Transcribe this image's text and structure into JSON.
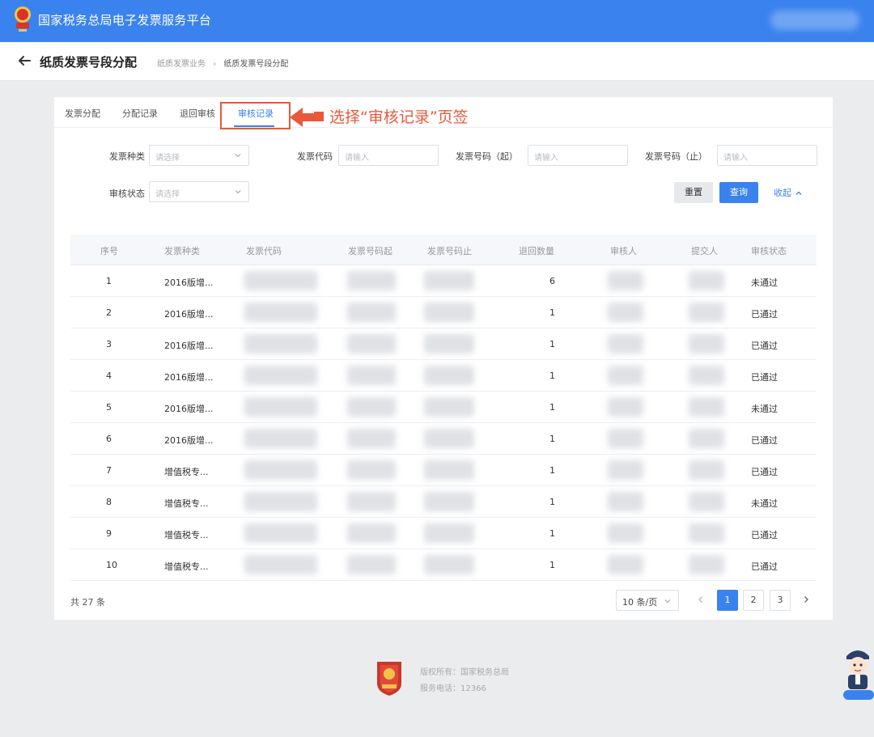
{
  "header": {
    "title": "国家税务总局电子发票服务平台"
  },
  "subheader": {
    "page_title": "纸质发票号段分配",
    "breadcrumb": [
      "纸质发票业务",
      "纸质发票号段分配"
    ]
  },
  "tabs": [
    {
      "label": "发票分配",
      "active": false
    },
    {
      "label": "分配记录",
      "active": false
    },
    {
      "label": "退回审核",
      "active": false
    },
    {
      "label": "审核记录",
      "active": true
    }
  ],
  "annotation": {
    "text": "选择“审核记录”页签",
    "color": "#e8593c"
  },
  "filters": {
    "invoice_type": {
      "label": "发票种类",
      "placeholder": "请选择"
    },
    "invoice_code": {
      "label": "发票代码",
      "placeholder": "请输入"
    },
    "number_start": {
      "label": "发票号码（起）",
      "placeholder": "请输入"
    },
    "number_end": {
      "label": "发票号码（止）",
      "placeholder": "请输入"
    },
    "review_status": {
      "label": "审核状态",
      "placeholder": "请选择"
    }
  },
  "buttons": {
    "reset": "重置",
    "query": "查询",
    "collapse": "收起"
  },
  "table": {
    "columns": [
      "序号",
      "发票种类",
      "发票代码",
      "发票号码起",
      "发票号码止",
      "退回数量",
      "审核人",
      "提交人",
      "审核状态"
    ],
    "rows": [
      {
        "no": "1",
        "type": "2016版增...",
        "qty": "6",
        "status": "未通过"
      },
      {
        "no": "2",
        "type": "2016版增...",
        "qty": "1",
        "status": "已通过"
      },
      {
        "no": "3",
        "type": "2016版增...",
        "qty": "1",
        "status": "已通过"
      },
      {
        "no": "4",
        "type": "2016版增...",
        "qty": "1",
        "status": "已通过"
      },
      {
        "no": "5",
        "type": "2016版增...",
        "qty": "1",
        "status": "未通过"
      },
      {
        "no": "6",
        "type": "2016版增...",
        "qty": "1",
        "status": "已通过"
      },
      {
        "no": "7",
        "type": "增值税专...",
        "qty": "1",
        "status": "已通过"
      },
      {
        "no": "8",
        "type": "增值税专...",
        "qty": "1",
        "status": "未通过"
      },
      {
        "no": "9",
        "type": "增值税专...",
        "qty": "1",
        "status": "已通过"
      },
      {
        "no": "10",
        "type": "增值税专...",
        "qty": "1",
        "status": "已通过"
      }
    ]
  },
  "pagination": {
    "total": "共 27 条",
    "page_size": "10 条/页",
    "pages": [
      "1",
      "2",
      "3"
    ],
    "current": "1"
  },
  "footer": {
    "copyright": "版权所有：国家税务总局",
    "phone": "服务电话：12366"
  },
  "colors": {
    "brand_blue": "#3a83ef",
    "annotation_red": "#e8593c"
  },
  "icons": {
    "back": "arrow-left-icon",
    "dropdown": "chevron-down-icon",
    "collapse": "chevron-up-icon",
    "prev": "chevron-left-icon",
    "next": "chevron-right-icon",
    "assistant": "assistant-avatar-icon"
  }
}
